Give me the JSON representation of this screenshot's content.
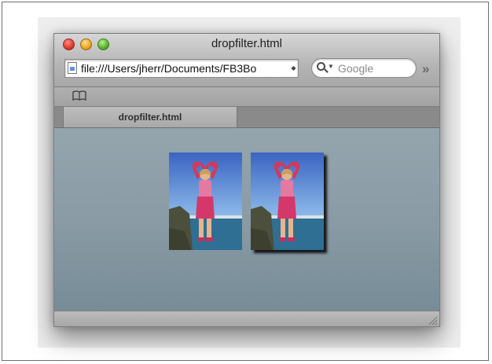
{
  "window": {
    "title": "dropfilter.html",
    "controls": [
      "close-button",
      "minimize-button",
      "zoom-button"
    ]
  },
  "toolbar": {
    "url": "file:///Users/jherr/Documents/FB3Bo",
    "search_placeholder": "Google",
    "overflow_icon": "chevron-double-right-icon"
  },
  "bookmarks": {
    "icon": "open-book-icon"
  },
  "tabs": [
    {
      "label": "dropfilter.html",
      "active": true
    }
  ],
  "content": {
    "images": [
      {
        "description": "photo-plain",
        "effect": "none"
      },
      {
        "description": "photo-with-drop-shadow",
        "effect": "drop-shadow"
      }
    ]
  },
  "colors": {
    "content_background": "#8e9fa9",
    "close": "#e0392c",
    "minimize": "#eaa420",
    "zoom": "#58b02c"
  }
}
